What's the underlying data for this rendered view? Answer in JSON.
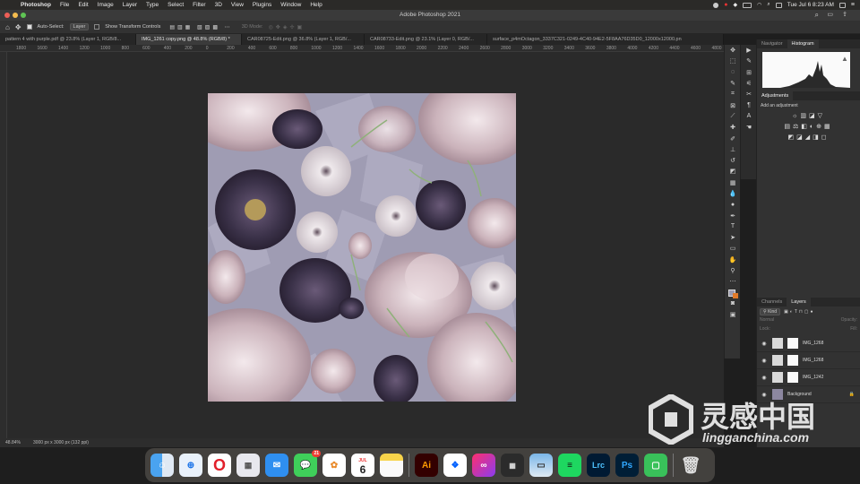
{
  "menubar": {
    "app": "Photoshop",
    "items": [
      "File",
      "Edit",
      "Image",
      "Layer",
      "Type",
      "Select",
      "Filter",
      "3D",
      "View",
      "Plugins",
      "Window",
      "Help"
    ],
    "clock": "Tue Jul 6  8:23 AM"
  },
  "window": {
    "title": "Adobe Photoshop 2021"
  },
  "options": {
    "auto_select_label": "Auto-Select:",
    "auto_select_value": "Layer",
    "transform_label": "Show Transform Controls",
    "mode_label": "3D Mode:"
  },
  "tabs": [
    "pattern 4 with purple.pdf @ 23.8% (Layer 1, RGB/8...",
    "IMG_1261 copy.png @ 48.8% (RGB/8) *",
    "CAR08725-Edit.png @ 36.8% (Layer 1, RGB/...",
    "CAR08733-Edit.png @ 23.1% (Layer 0, RGB/...",
    "surface_p4mOctagon_3337C321-0249-4C40-94E2-5F8AA76D35D0_12000x12000.pn"
  ],
  "ruler": [
    "1800",
    "1600",
    "1400",
    "1200",
    "1000",
    "800",
    "600",
    "400",
    "200",
    "0",
    "200",
    "400",
    "600",
    "800",
    "1000",
    "1200",
    "1400",
    "1600",
    "1800",
    "2000",
    "2200",
    "2400",
    "2600",
    "2800",
    "3000",
    "3200",
    "3400",
    "3600",
    "3800",
    "4000",
    "4200",
    "4400",
    "4600",
    "4800"
  ],
  "status": {
    "zoom": "48.84%",
    "doc": "3000 px x 3000 px (132 ppi)"
  },
  "panels": {
    "top_tabs": [
      "Navigator",
      "Histogram"
    ],
    "adjustments_title": "Adjustments",
    "adjustments_hint": "Add an adjustment",
    "layer_tabs": [
      "Channels",
      "Layers"
    ],
    "kind": "Kind",
    "blend": "Normal",
    "opacity": "Opacity:",
    "lock": "Lock:",
    "fill": "Fill:",
    "layers": [
      "IMG_1268",
      "IMG_1268",
      "IMG_1242",
      "Background"
    ]
  },
  "watermark": {
    "cn": "灵感中国",
    "en": "lingganchina.com"
  },
  "dock_apps": [
    "finder-icon",
    "safari-icon",
    "opera-icon",
    "launchpad-icon",
    "mail-icon",
    "messages-icon",
    "photos-icon",
    "calendar-icon",
    "notes-icon",
    "illustrator-icon",
    "dropbox-icon",
    "creative-cloud-icon",
    "calculator-icon",
    "preview-icon",
    "spotify-icon",
    "lightroom-icon",
    "photoshop-icon",
    "facetime-icon",
    "trash-icon"
  ],
  "dock_labels": {
    "calendar_month": "JUL",
    "calendar_day": "6",
    "ai": "Ai",
    "lrc": "Lrc",
    "ps": "Ps",
    "messages_badge": "21"
  }
}
